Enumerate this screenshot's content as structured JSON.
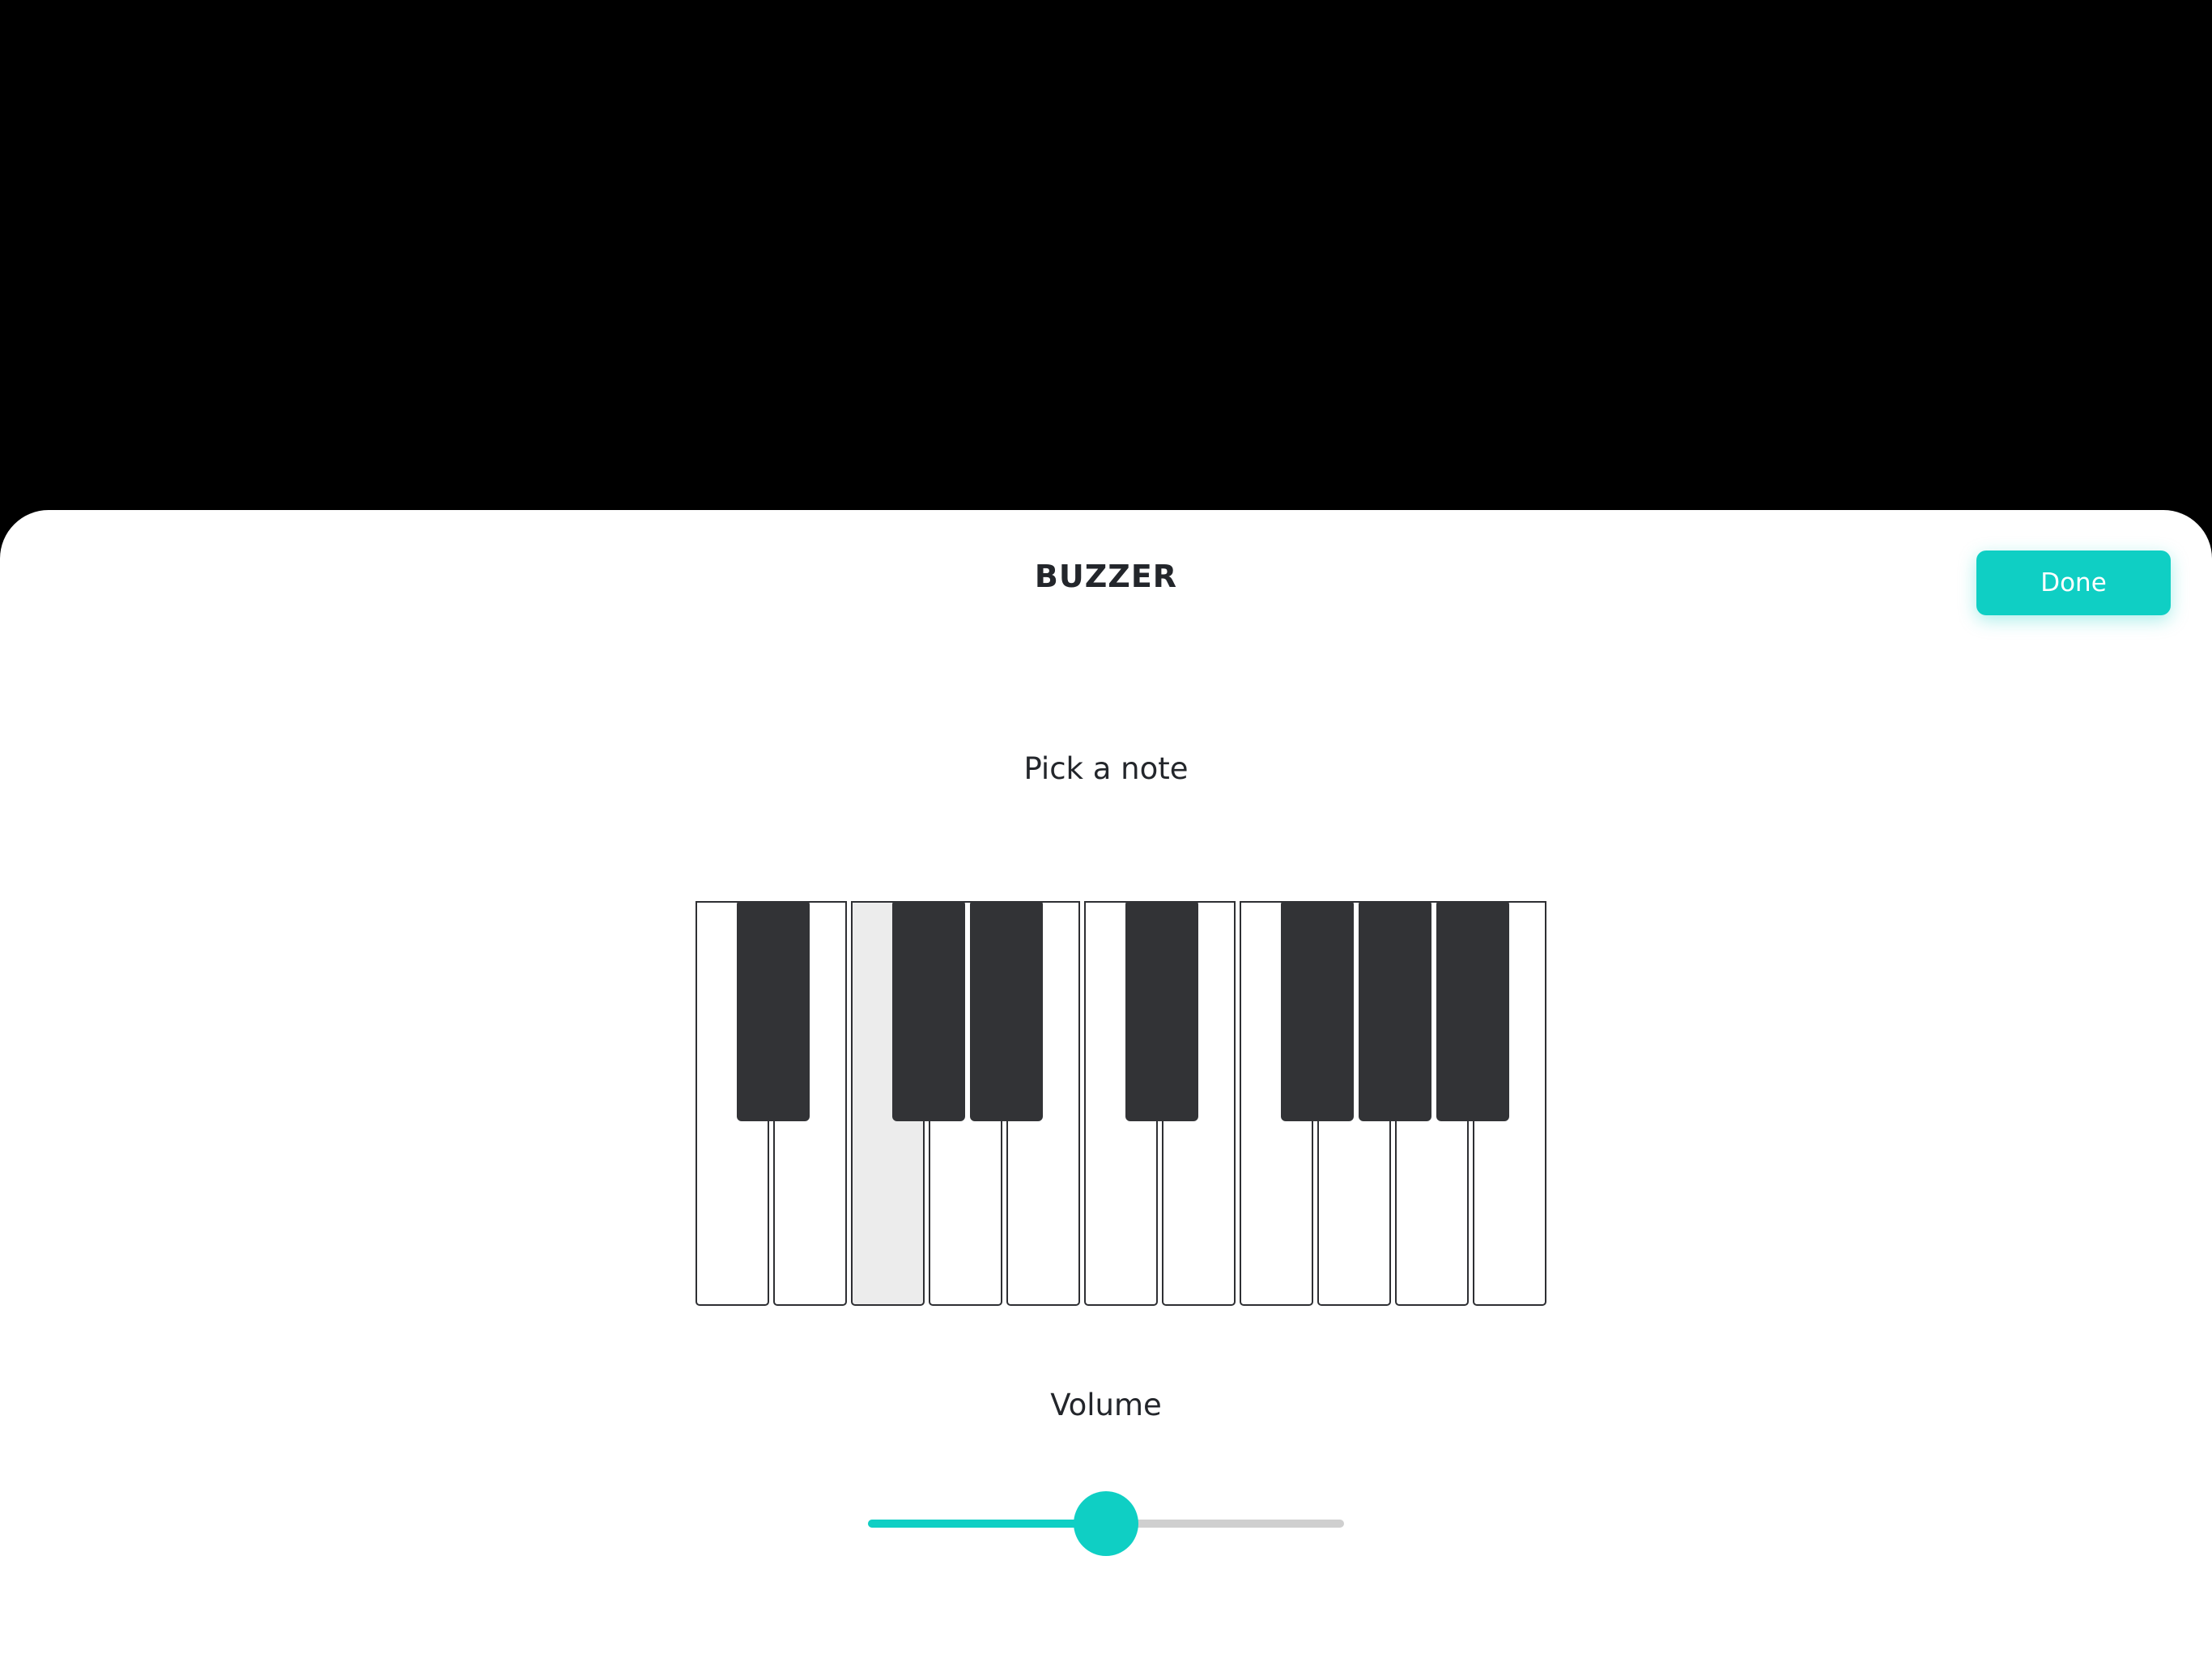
{
  "sheet": {
    "title": "BUZZER",
    "done_label": "Done"
  },
  "note_picker": {
    "label": "Pick a note",
    "white_key_count": 11,
    "selected_white_key": 2,
    "black_keys_after_white": [
      0,
      2,
      3,
      5,
      7,
      8,
      9
    ]
  },
  "volume": {
    "label": "Volume",
    "level": 0.5
  },
  "colors": {
    "accent": "#0fcfc4",
    "black_key": "#323336",
    "selected_key": "#ececec",
    "track": "#cfcfcf"
  }
}
